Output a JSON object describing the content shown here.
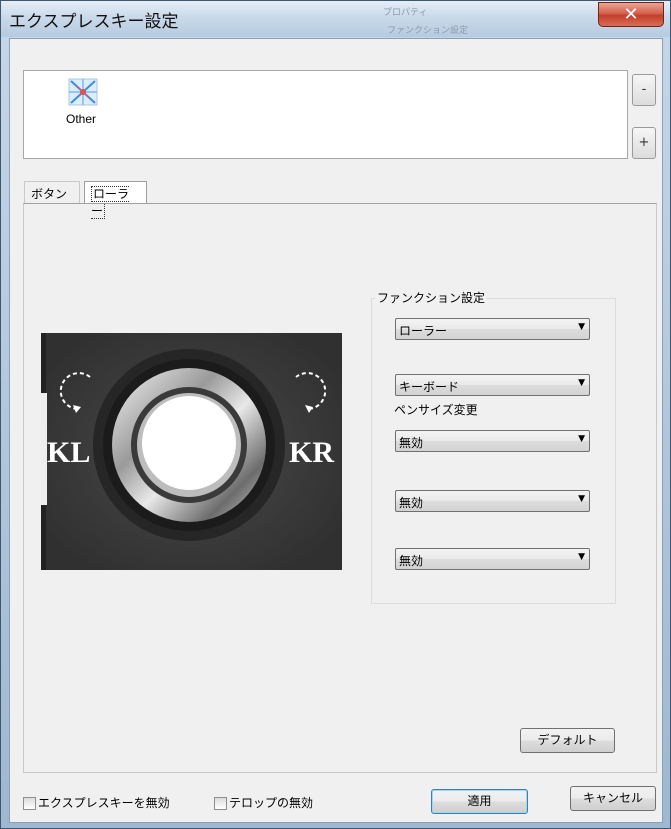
{
  "window": {
    "title": "エクスプレスキー設定",
    "close_glyph": "✕",
    "ghost_text_1": "プロパティ",
    "ghost_text_2": "ファンクション設定"
  },
  "applications": {
    "items": [
      {
        "label": "Other",
        "icon": "other-apps-icon"
      }
    ],
    "remove_label": "-",
    "add_label": "+"
  },
  "tabs": [
    {
      "label": "ボタン",
      "selected": false
    },
    {
      "label": "ローラー",
      "selected": true
    }
  ],
  "device": {
    "left_label": "KL",
    "right_label": "KR"
  },
  "function_settings": {
    "group_label": "ファンクション設定",
    "roller_function": "ローラー",
    "keyboard_function": "キーボード",
    "keyboard_sublabel": "ペンサイズ変更",
    "slot_1": "無効",
    "slot_2": "無効",
    "slot_3": "無効"
  },
  "buttons": {
    "default": "デフォルト",
    "apply": "適用",
    "cancel": "キャンセル"
  },
  "checkboxes": {
    "disable_expresskeys": "エクスプレスキーを無効",
    "disable_telop": "テロップの無効"
  }
}
